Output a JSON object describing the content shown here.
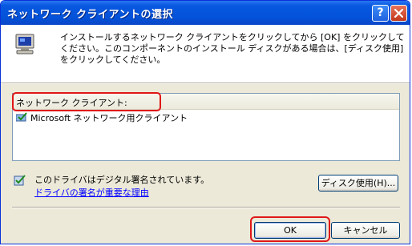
{
  "window": {
    "title": "ネットワーク クライアントの選択",
    "help_label": "?",
    "close_label": "×"
  },
  "header": {
    "instruction": "インストールするネットワーク クライアントをクリックしてから [OK] をクリックしてください。このコンポーネントのインストール ディスクがある場合は、[ディスク使用] をクリックしてください。"
  },
  "list": {
    "column_header": "ネットワーク クライアント:",
    "items": [
      {
        "label": "Microsoft ネットワーク用クライアント"
      }
    ]
  },
  "signature": {
    "text": "このドライバはデジタル署名されています。",
    "link": "ドライバの署名が重要な理由"
  },
  "buttons": {
    "disk": "ディスク使用(H)...",
    "ok": "OK",
    "cancel": "キャンセル"
  },
  "colors": {
    "titlebar": "#0352d9",
    "highlight": "#e01818",
    "link": "#0000ff",
    "dialog_bg": "#ece9d8"
  }
}
